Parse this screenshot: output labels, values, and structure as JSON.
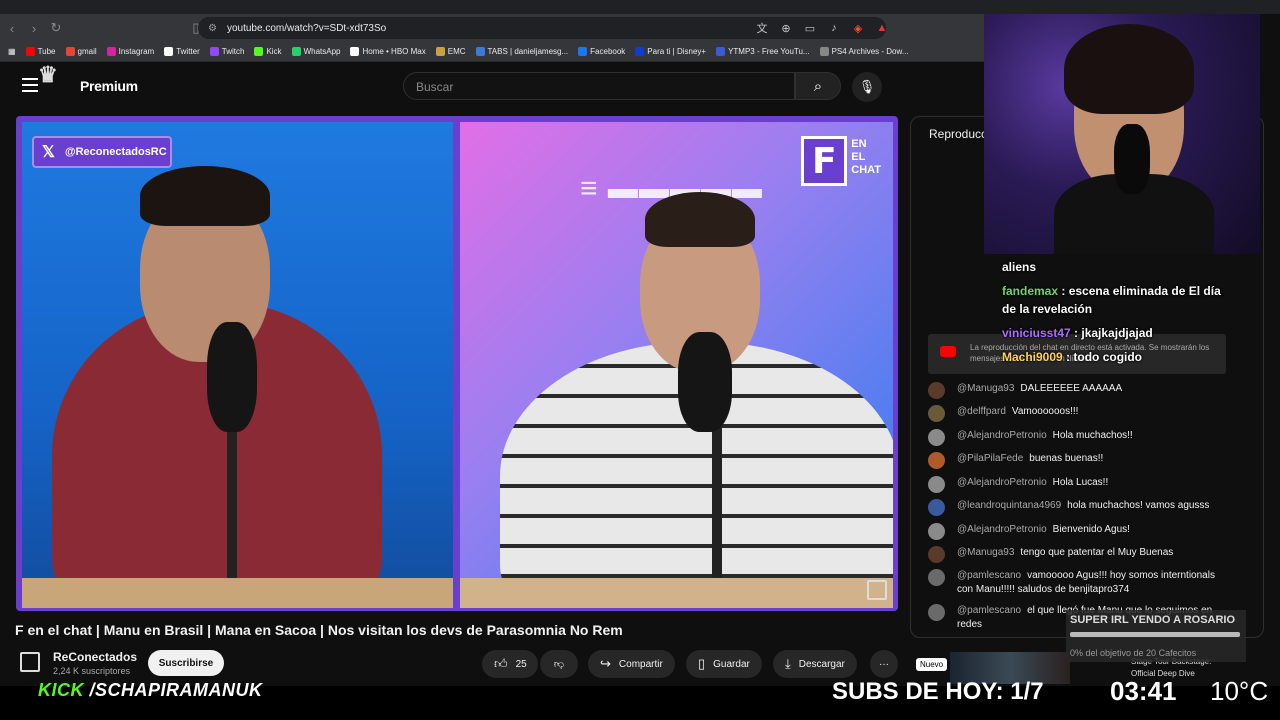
{
  "browser": {
    "url": "youtube.com/watch?v=SDt-xdt73So",
    "bookmarks": [
      {
        "label": "Tube",
        "color": "#ff0000"
      },
      {
        "label": "gmail",
        "color": "#ea4335"
      },
      {
        "label": "Instagram",
        "color": "#d6249f"
      },
      {
        "label": "Twitter",
        "color": "#ffffff"
      },
      {
        "label": "Twitch",
        "color": "#9146ff"
      },
      {
        "label": "Kick",
        "color": "#53fc18"
      },
      {
        "label": "WhatsApp",
        "color": "#25d366"
      },
      {
        "label": "Home • HBO Max",
        "color": "#ffffff"
      },
      {
        "label": "EMC",
        "color": "#c9a23a"
      },
      {
        "label": "TABS | danieljamesg...",
        "color": "#3a7bd5"
      },
      {
        "label": "Facebook",
        "color": "#1877f2"
      },
      {
        "label": "Para ti | Disney+",
        "color": "#113ccf"
      },
      {
        "label": "YTMP3 - Free YouTu...",
        "color": "#3a5bd5"
      },
      {
        "label": "PS4 Archives - Dow...",
        "color": "#888888"
      }
    ]
  },
  "youtube": {
    "logo_text": "Premium",
    "search_placeholder": "Buscar",
    "video": {
      "x_handle": "@ReconectadosRC",
      "badge_letter": "F",
      "badge_text_1": "EN",
      "badge_text_2": "EL",
      "badge_text_3": "CHAT"
    },
    "title": "F en el chat | Manu en Brasil | Mana en Sacoa | Nos visitan los devs de Parasomnia No Rem",
    "channel": {
      "name": "ReConectados",
      "subscribers": "2,24 K suscriptores",
      "subscribe_label": "Suscribirse"
    },
    "actions": {
      "likes": "25",
      "share": "Compartir",
      "save": "Guardar",
      "download": "Descargar",
      "more": "···"
    },
    "new_tag": "Nuevo",
    "chat_header": "Reproducción",
    "notice": "La reproducción del chat en directo está activada. Se mostrarán los mensajes de la emisión en directo.",
    "chat": [
      {
        "author": "@Manuga93",
        "text": "DALEEEEEE AAAAAA",
        "avatar": "#5a3a2a"
      },
      {
        "author": "@delffpard",
        "text": "Vamoooooos!!!",
        "avatar": "#6a5a3a"
      },
      {
        "author": "@AlejandroPetronio",
        "text": "Hola muchachos!!",
        "avatar": "#8a8a8a"
      },
      {
        "author": "@PilaPilaFede",
        "text": "buenas buenas!!",
        "avatar": "#b05a2a"
      },
      {
        "author": "@AlejandroPetronio",
        "text": "Hola Lucas!!",
        "avatar": "#8a8a8a"
      },
      {
        "author": "@leandroquintana4969",
        "text": "hola muchachos! vamos agusss",
        "avatar": "#3a5aa0"
      },
      {
        "author": "@AlejandroPetronio",
        "text": "Bienvenido Agus!",
        "avatar": "#8a8a8a"
      },
      {
        "author": "@Manuga93",
        "text": "tengo que patentar el Muy Buenas",
        "avatar": "#5a3a2a"
      },
      {
        "author": "@pamlescano",
        "text": "vamooooo Agus!!! hoy somos interntionals con Manu!!!!! saludos de benjitapro374",
        "avatar": "#6a6a6a"
      },
      {
        "author": "@pamlescano",
        "text": "el que llegó fue Manu que lo seguimos en redes",
        "avatar": "#6a6a6a"
      }
    ]
  },
  "stream_overlay": {
    "chat": [
      {
        "user": "",
        "text": "aliens",
        "color": "#ffffff"
      },
      {
        "user": "fandemax",
        "text": " : escena eliminada de El día de la revelación",
        "color": "#6bd66b"
      },
      {
        "user": "viniciusst47",
        "text": " : jkajkajdjajad",
        "color": "#b06bff"
      },
      {
        "user": "Machi9009",
        "text": " : todo cogido",
        "color": "#ffd35a"
      }
    ],
    "kick_label": "KICK",
    "kick_handle": "/SCHAPIRAMANUK",
    "subs_today": "SUBS DE HOY: 1/7",
    "clock": "03:41",
    "temperature": "10°C",
    "goal_title": "SUPER IRL YENDO A ROSARIO",
    "goal_progress_text": "0% del objetivo de 20 Cafecitos",
    "goal_fraction": 0,
    "thumb_text_1": "Stage Tour Backstage:",
    "thumb_text_2": "Official Deep Dive"
  }
}
